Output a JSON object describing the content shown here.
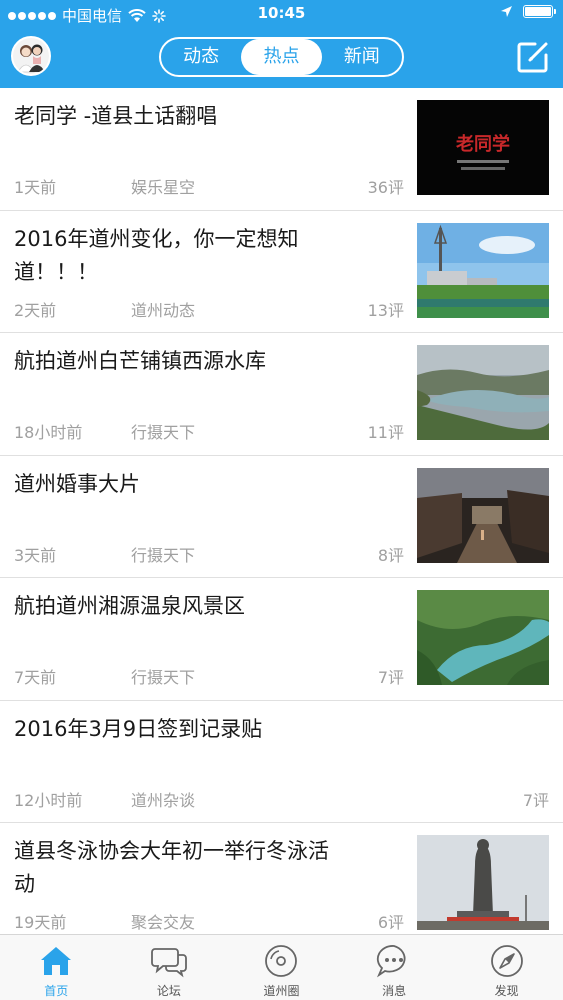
{
  "status_bar": {
    "carrier": "中国电信",
    "time": "10:45"
  },
  "header": {
    "tabs": [
      {
        "label": "动态",
        "active": false
      },
      {
        "label": "热点",
        "active": true
      },
      {
        "label": "新闻",
        "active": false
      }
    ],
    "accent_color": "#2aa3ea"
  },
  "articles": [
    {
      "title": "老同学 -道县土话翻唱",
      "time": "1天前",
      "source": "娱乐星空",
      "comments": "36评",
      "thumb": "poster-dark",
      "thumb_text": "老同学"
    },
    {
      "title": "2016年道州变化，你一定想知道！！！",
      "time": "2天前",
      "source": "道州动态",
      "comments": "13评",
      "thumb": "tower-river"
    },
    {
      "title": "航拍道州白芒铺镇西源水库",
      "time": "18小时前",
      "source": "行摄天下",
      "comments": "11评",
      "thumb": "reservoir"
    },
    {
      "title": "道州婚事大片",
      "time": "3天前",
      "source": "行摄天下",
      "comments": "8评",
      "thumb": "village-street"
    },
    {
      "title": "航拍道州湘源温泉风景区",
      "time": "7天前",
      "source": "行摄天下",
      "comments": "7评",
      "thumb": "green-lake"
    },
    {
      "title": "2016年3月9日签到记录贴",
      "time": "12小时前",
      "source": "道州杂谈",
      "comments": "7评",
      "thumb": null
    },
    {
      "title": "道县冬泳协会大年初一举行冬泳活动",
      "time": "19天前",
      "source": "聚会交友",
      "comments": "6评",
      "thumb": "statue"
    }
  ],
  "tabbar": [
    {
      "label": "首页",
      "icon": "home-icon",
      "active": true
    },
    {
      "label": "论坛",
      "icon": "chat-bubbles-icon",
      "active": false
    },
    {
      "label": "道州圈",
      "icon": "circle-disc-icon",
      "active": false
    },
    {
      "label": "消息",
      "icon": "message-icon",
      "active": false
    },
    {
      "label": "发现",
      "icon": "compass-icon",
      "active": false
    }
  ]
}
